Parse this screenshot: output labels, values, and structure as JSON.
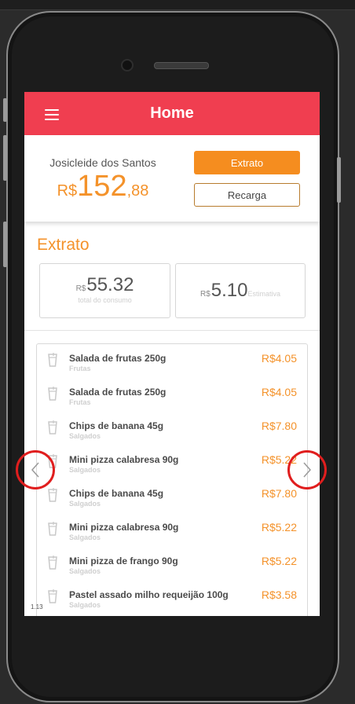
{
  "app": {
    "title": "Home"
  },
  "account": {
    "name": "Josicleide dos Santos",
    "currency": "R$",
    "balance_integer": "152",
    "balance_cents": ",88"
  },
  "actions": {
    "extrato_label": "Extrato",
    "recarga_label": "Recarga"
  },
  "statement": {
    "title": "Extrato",
    "consumption": {
      "currency": "R$",
      "value": "55.32",
      "label": "total do consumo"
    },
    "estimate": {
      "currency": "R$",
      "value": "5.10",
      "label": "Estimativa"
    }
  },
  "items": [
    {
      "name": "Salada de frutas 250g",
      "category": "Frutas",
      "price": "R$4.05"
    },
    {
      "name": "Salada de frutas 250g",
      "category": "Frutas",
      "price": "R$4.05"
    },
    {
      "name": "Chips de banana 45g",
      "category": "Salgados",
      "price": "R$7.80"
    },
    {
      "name": "Mini pizza calabresa 90g",
      "category": "Salgados",
      "price": "R$5.22"
    },
    {
      "name": "Chips de banana 45g",
      "category": "Salgados",
      "price": "R$7.80"
    },
    {
      "name": "Mini pizza calabresa 90g",
      "category": "Salgados",
      "price": "R$5.22"
    },
    {
      "name": "Mini pizza de frango 90g",
      "category": "Salgados",
      "price": "R$5.22"
    },
    {
      "name": "Pastel assado milho requeijão 100g",
      "category": "Salgados",
      "price": "R$3.58"
    }
  ],
  "version": "1.13",
  "icons": {
    "menu": "hamburger-menu-icon",
    "item": "cup-icon",
    "prev": "chevron-left-icon",
    "next": "chevron-right-icon"
  },
  "colors": {
    "header": "#f03e50",
    "accent": "#f4922a",
    "button": "#f58d1f",
    "annotation": "#e01e1e"
  }
}
